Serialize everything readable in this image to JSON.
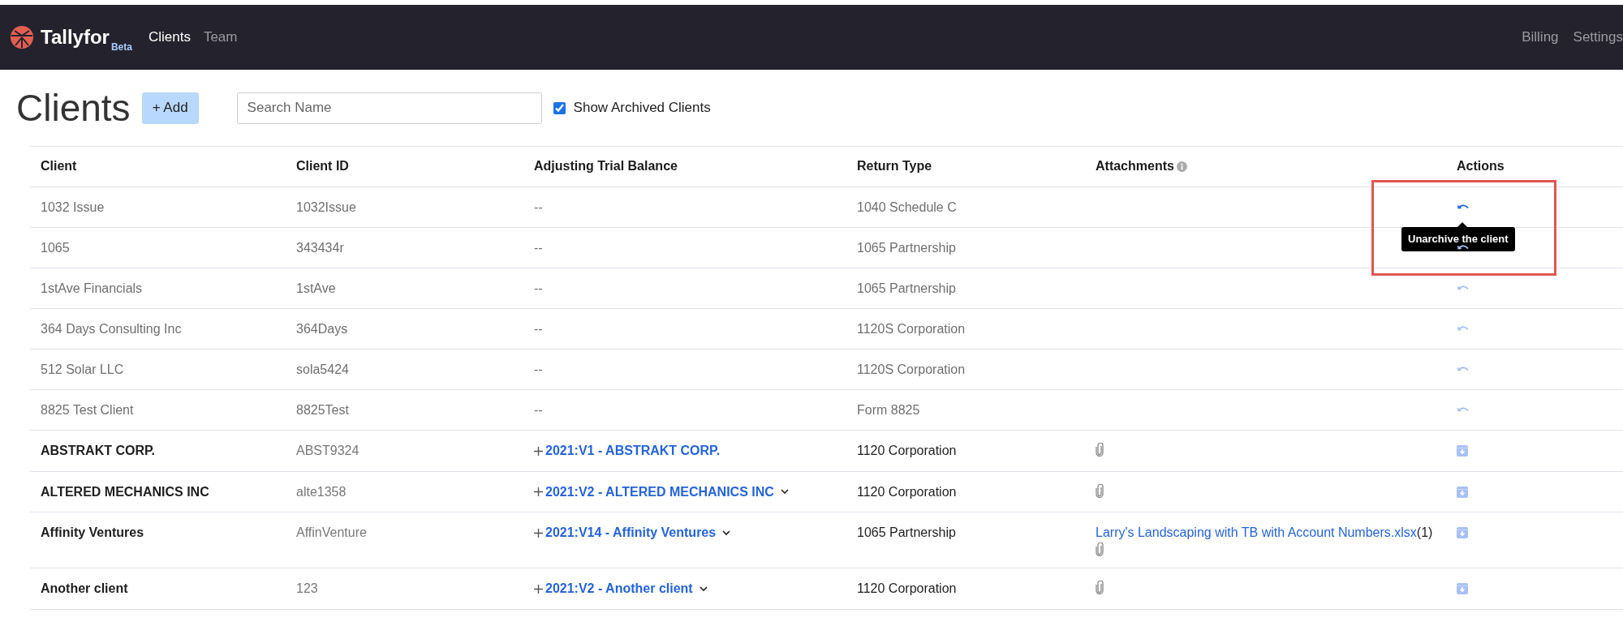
{
  "nav": {
    "brand": "Tallyfor",
    "badge": "Beta",
    "links": [
      {
        "label": "Clients",
        "selected": true
      },
      {
        "label": "Team",
        "selected": false
      }
    ],
    "right_links": [
      "Billing",
      "Settings"
    ]
  },
  "page": {
    "title": "Clients",
    "add_button": "+ Add",
    "search": {
      "placeholder": "Search Name"
    },
    "show_archived": {
      "label": "Show Archived Clients",
      "checked": true
    }
  },
  "table": {
    "columns": [
      {
        "label": "Client",
        "info_icon": false
      },
      {
        "label": "Client ID",
        "info_icon": false
      },
      {
        "label": "Adjusting Trial Balance",
        "info_icon": false
      },
      {
        "label": "Return Type",
        "info_icon": false
      },
      {
        "label": "Attachments",
        "info_icon": true
      },
      {
        "label": "Actions",
        "info_icon": false
      }
    ],
    "rows": [
      {
        "client": "1032 Issue",
        "client_id": "1032Issue",
        "trial_balance": {
          "kind": "none",
          "text": "--"
        },
        "return_type": "1040 Schedule C",
        "archived": true,
        "hovered": true,
        "tooltip": "Unarchive the client"
      },
      {
        "client": "1065",
        "client_id": "343434r",
        "trial_balance": {
          "kind": "none",
          "text": "--"
        },
        "return_type": "1065 Partnership",
        "archived": true,
        "hovered": false
      },
      {
        "client": "1stAve Financials",
        "client_id": "1stAve",
        "trial_balance": {
          "kind": "none",
          "text": "--"
        },
        "return_type": "1065 Partnership",
        "archived": true,
        "hovered": false
      },
      {
        "client": "364 Days Consulting Inc",
        "client_id": "364Days",
        "trial_balance": {
          "kind": "none",
          "text": "--"
        },
        "return_type": "1120S Corporation",
        "archived": true,
        "hovered": false
      },
      {
        "client": "512 Solar LLC",
        "client_id": "sola5424",
        "trial_balance": {
          "kind": "none",
          "text": "--"
        },
        "return_type": "1120S Corporation",
        "archived": true,
        "hovered": false
      },
      {
        "client": "8825 Test Client",
        "client_id": "8825Test",
        "trial_balance": {
          "kind": "none",
          "text": "--"
        },
        "return_type": "Form 8825",
        "archived": true,
        "hovered": false
      },
      {
        "client": "ABSTRAKT CORP.",
        "client_id": "ABST9324",
        "trial_balance": {
          "kind": "link",
          "text": "2021:V1 - ABSTRAKT CORP.",
          "dropdown": false
        },
        "return_type": "1120 Corporation",
        "archived": false,
        "hovered": false
      },
      {
        "client": "ALTERED MECHANICS INC",
        "client_id": "alte1358",
        "trial_balance": {
          "kind": "link",
          "text": "2021:V2 - ALTERED MECHANICS INC",
          "dropdown": true
        },
        "return_type": "1120 Corporation",
        "archived": false,
        "hovered": false
      },
      {
        "client": "Affinity Ventures",
        "client_id": "AffinVenture",
        "trial_balance": {
          "kind": "link",
          "text": "2021:V14 - Affinity Ventures",
          "dropdown": true
        },
        "return_type": "1065 Partnership",
        "archived": false,
        "hovered": false,
        "files": [
          {
            "name": "Larry's Landscaping with TB with Account Numbers.xlsx",
            "count": "(1)"
          }
        ]
      },
      {
        "client": "Another client",
        "client_id": "123",
        "trial_balance": {
          "kind": "link",
          "text": "2021:V2 - Another client",
          "dropdown": true
        },
        "return_type": "1120 Corporation",
        "archived": false,
        "hovered": false
      }
    ]
  }
}
